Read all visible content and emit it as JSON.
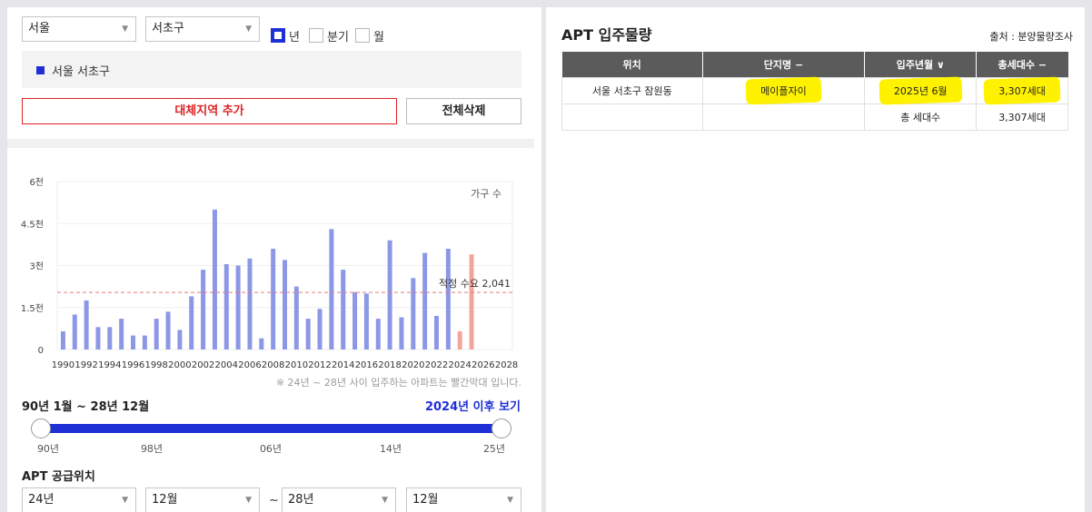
{
  "filters": {
    "city": "서울",
    "district": "서초구",
    "periods": [
      {
        "label": "년",
        "checked": true
      },
      {
        "label": "분기",
        "checked": false
      },
      {
        "label": "월",
        "checked": false
      }
    ]
  },
  "region": {
    "label": "서울 서초구"
  },
  "buttons": {
    "add_region": "대체지역 추가",
    "delete_all": "전체삭제"
  },
  "chart_data": {
    "type": "bar",
    "legend": "가구 수",
    "categories": [
      1990,
      1991,
      1992,
      1993,
      1994,
      1995,
      1996,
      1997,
      1998,
      1999,
      2000,
      2001,
      2002,
      2003,
      2004,
      2005,
      2006,
      2007,
      2008,
      2009,
      2010,
      2011,
      2012,
      2013,
      2014,
      2015,
      2016,
      2017,
      2018,
      2019,
      2020,
      2021,
      2022,
      2023,
      2024,
      2025,
      2026,
      2027,
      2028
    ],
    "values": [
      650,
      1250,
      1750,
      800,
      800,
      1100,
      500,
      500,
      1100,
      1350,
      700,
      1900,
      2850,
      5000,
      3050,
      3000,
      3250,
      400,
      3600,
      3200,
      2250,
      1100,
      1450,
      4300,
      2850,
      2050,
      2000,
      1100,
      3900,
      1150,
      2550,
      3450,
      1200,
      3600,
      650,
      3400,
      0,
      0,
      0
    ],
    "xtick_labels": [
      "1990",
      "1992",
      "1994",
      "1996",
      "1998",
      "2000",
      "2002",
      "2004",
      "2006",
      "2008",
      "2010",
      "2012",
      "2014",
      "2016",
      "2018",
      "2020",
      "2022",
      "2024",
      "2026",
      "2028"
    ],
    "ytick_labels": [
      "0",
      "1.5천",
      "3천",
      "4.5천",
      "6천"
    ],
    "ylim": [
      0,
      6000
    ],
    "highlight_from": 2024,
    "reference_line": {
      "value": 2041,
      "label": "적정 수요 2,041"
    },
    "colors": {
      "normal": "#8c97e6",
      "future": "#f2a59a",
      "reference": "#e67a7a"
    },
    "grid": true,
    "legend_position": "top-right"
  },
  "chart_note": "※ 24년 ~ 28년 사이 입주하는 아파트는 빨간막대 입니다.",
  "range": {
    "title": "90년 1월 ~ 28년 12월",
    "link": "2024년 이후 보기",
    "ticks": [
      "90년",
      "98년",
      "06년",
      "14년",
      "25년"
    ]
  },
  "supply": {
    "title": "APT 공급위치",
    "from_year": "24년",
    "from_month": "12월",
    "separator": "~",
    "to_year": "28년",
    "to_month": "12월"
  },
  "apt": {
    "title": "APT 입주물량",
    "source": "출처 : 분양물량조사",
    "headers": [
      "위치",
      "단지명 −",
      "입주년월 ∨",
      "총세대수 −"
    ],
    "row": {
      "location": "서울 서초구 잠원동",
      "complex": "메이플자이",
      "date": "2025년 6월",
      "units": "3,307세대"
    },
    "total_label": "총 세대수",
    "total_units": "3,307세대",
    "highlight_color": "#fff200"
  }
}
